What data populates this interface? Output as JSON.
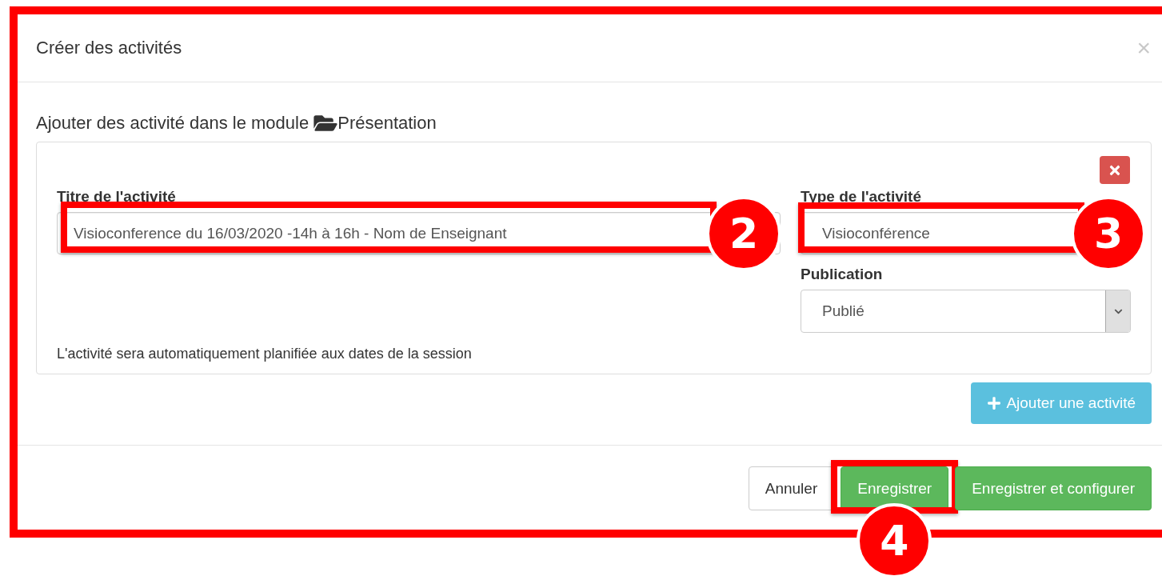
{
  "dialog": {
    "title": "Créer des activités",
    "close": "×",
    "highlighted": true
  },
  "heading": {
    "text": "Ajouter des activité dans le module",
    "module": "Présentation"
  },
  "activity": {
    "title_field": {
      "label": "Titre de l'activité",
      "value": "Visioconference du 16/03/2020 -14h à 16h - Nom de Enseignant",
      "highlighted": true,
      "callout": "2"
    },
    "type_field": {
      "label": "Type de l'activité",
      "value": "Visioconférence",
      "highlighted": true,
      "callout": "3"
    },
    "publication_field": {
      "label": "Publication",
      "value": "Publié"
    },
    "note": "L'activité sera automatiquement planifiée aux dates de la session"
  },
  "add_button": "Ajouter une activité",
  "buttons": [
    {
      "label": "Annuler",
      "kind": "default",
      "highlighted": false
    },
    {
      "label": "Enregistrer",
      "kind": "success",
      "highlighted": true,
      "callout": "4"
    },
    {
      "label": "Enregistrer et configurer",
      "kind": "success",
      "highlighted": false
    }
  ]
}
